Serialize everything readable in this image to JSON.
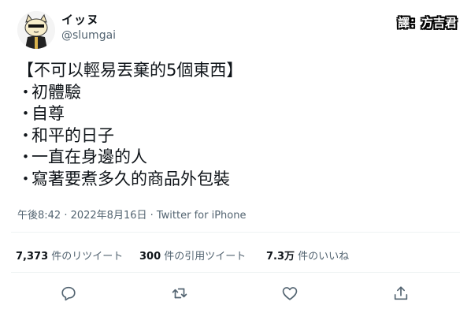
{
  "author": {
    "name": "イッヌ",
    "handle": "@slumgai"
  },
  "translator_badge": "譯：方吉君",
  "tweet": {
    "title": "【不可以輕易丟棄的5個東西】",
    "items": [
      "初體驗",
      "自尊",
      "和平的日子",
      "一直在身邊的人",
      "寫著要煮多久的商品外包裝"
    ],
    "bullet": "・"
  },
  "meta": {
    "text": "午後8:42 · 2022年8月16日 · Twitter for iPhone"
  },
  "stats": {
    "retweets_count": "7,373",
    "retweets_label": " 件のリツイート",
    "quotes_count": "300",
    "quotes_label": " 件の引用ツイート",
    "likes_count": "7.3万",
    "likes_label": " 件のいいね"
  },
  "actions": {
    "reply_icon": "reply-icon",
    "retweet_icon": "retweet-icon",
    "like_icon": "heart-icon",
    "share_icon": "share-icon"
  },
  "colors": {
    "text": "#0f1419",
    "secondary": "#536471",
    "divider": "#eff3f4"
  }
}
